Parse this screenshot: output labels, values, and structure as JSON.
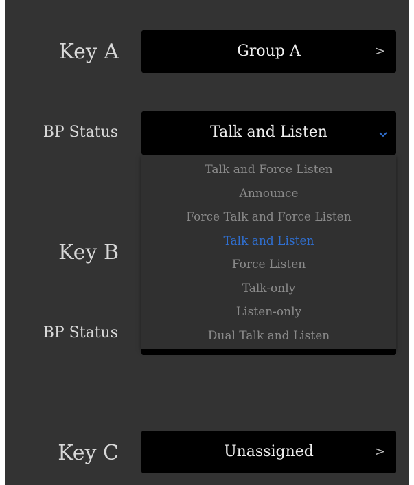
{
  "key_a": {
    "label": "Key A",
    "group_value": "Group A",
    "bp_status_label": "BP Status",
    "bp_status_value": "Talk and Listen"
  },
  "key_b": {
    "label": "Key B",
    "bp_status_label": "BP Status"
  },
  "key_c": {
    "label": "Key C",
    "group_value": "Unassigned"
  },
  "dropdown": {
    "options": [
      "Talk and Force Listen",
      "Announce",
      "Force Talk and Force Listen",
      "Talk and Listen",
      "Force Listen",
      "Talk-only",
      "Listen-only",
      "Dual Talk and Listen"
    ],
    "selected": "Talk and Listen"
  },
  "icons": {
    "chevron_right": "chevron-right-icon",
    "chevron_down": "chevron-down-icon"
  },
  "colors": {
    "panel_bg": "#333333",
    "button_bg": "#000000",
    "selected_option": "#2f6fd0",
    "option_text": "#8a8a8a"
  }
}
